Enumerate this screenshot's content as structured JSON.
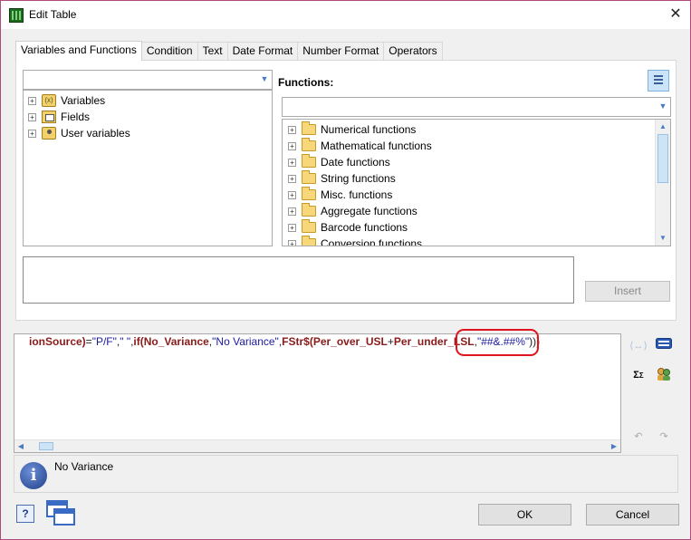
{
  "window": {
    "title": "Edit Table"
  },
  "tabs": [
    {
      "label": "Variables and Functions"
    },
    {
      "label": "Condition"
    },
    {
      "label": "Text"
    },
    {
      "label": "Date Format"
    },
    {
      "label": "Number Format"
    },
    {
      "label": "Operators"
    }
  ],
  "left_tree": {
    "items": [
      {
        "label": "Variables",
        "icon": "variables-icon"
      },
      {
        "label": "Fields",
        "icon": "fields-icon"
      },
      {
        "label": "User variables",
        "icon": "user-variables-icon"
      }
    ]
  },
  "functions": {
    "label": "Functions:",
    "items": [
      {
        "label": "Numerical functions"
      },
      {
        "label": "Mathematical functions"
      },
      {
        "label": "Date functions"
      },
      {
        "label": "String functions"
      },
      {
        "label": "Misc. functions"
      },
      {
        "label": "Aggregate functions"
      },
      {
        "label": "Barcode functions"
      },
      {
        "label": "Conversion functions"
      }
    ]
  },
  "insert_button": {
    "label": "Insert"
  },
  "editor": {
    "segments": [
      {
        "text": "ionSource)",
        "kind": "fn"
      },
      {
        "text": "=",
        "kind": "op"
      },
      {
        "text": "\"P/F\"",
        "kind": "str"
      },
      {
        "text": ",",
        "kind": "op"
      },
      {
        "text": "\" \"",
        "kind": "str"
      },
      {
        "text": ",",
        "kind": "op"
      },
      {
        "text": "if(",
        "kind": "fn"
      },
      {
        "text": "No_Variance",
        "kind": "fn"
      },
      {
        "text": ",",
        "kind": "op"
      },
      {
        "text": "\"No Variance\"",
        "kind": "str"
      },
      {
        "text": ",",
        "kind": "op"
      },
      {
        "text": "FStr$(",
        "kind": "fn"
      },
      {
        "text": "Per_over_USL",
        "kind": "fn"
      },
      {
        "text": "+",
        "kind": "op"
      },
      {
        "text": "Per_under_LSL",
        "kind": "fn"
      },
      {
        "text": ",",
        "kind": "op"
      },
      {
        "text": "\"##&.##%\"",
        "kind": "str"
      },
      {
        "text": ")))",
        "kind": "op"
      }
    ]
  },
  "info": {
    "text": "No Variance"
  },
  "buttons": {
    "ok": "OK",
    "cancel": "Cancel"
  }
}
